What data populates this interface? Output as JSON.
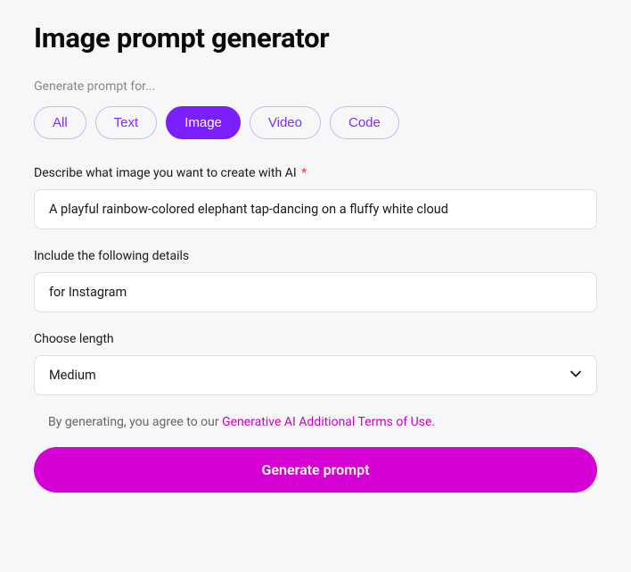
{
  "title": "Image prompt generator",
  "prompt_for_label": "Generate prompt for...",
  "tabs": {
    "all": "All",
    "text": "Text",
    "image": "Image",
    "video": "Video",
    "code": "Code"
  },
  "form": {
    "describe": {
      "label": "Describe what image you want to create with AI",
      "required_marker": "*",
      "value": "A playful rainbow-colored elephant tap-dancing on a fluffy white cloud"
    },
    "details": {
      "label": "Include the following details",
      "value": "for Instagram"
    },
    "length": {
      "label": "Choose length",
      "value": "Medium"
    }
  },
  "terms": {
    "prefix": "By generating, you agree to our ",
    "link_text": "Generative AI Additional Terms of Use."
  },
  "generate_button": "Generate prompt"
}
